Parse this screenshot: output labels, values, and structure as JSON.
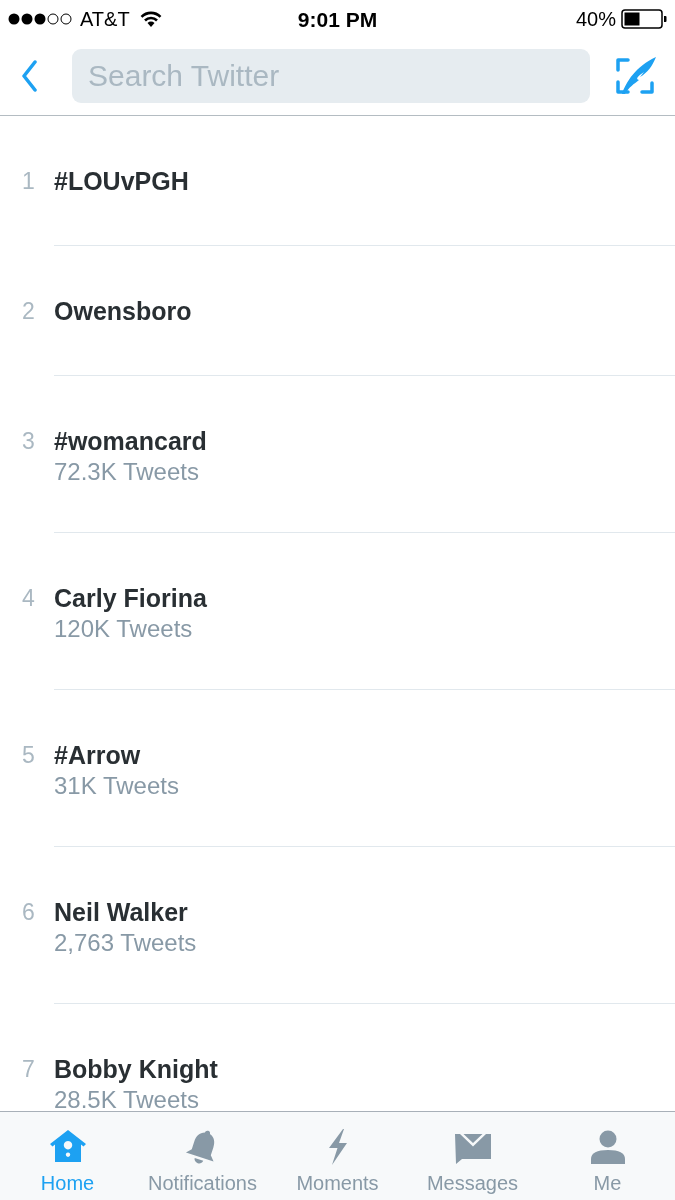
{
  "status_bar": {
    "carrier": "AT&T",
    "time": "9:01 PM",
    "battery": "40%"
  },
  "search": {
    "placeholder": "Search Twitter"
  },
  "trends": [
    {
      "rank": "1",
      "name": "#LOUvPGH"
    },
    {
      "rank": "2",
      "name": "Owensboro"
    },
    {
      "rank": "3",
      "name": "#womancard",
      "tweet_count": "72.3K Tweets"
    },
    {
      "rank": "4",
      "name": "Carly Fiorina",
      "tweet_count": "120K Tweets"
    },
    {
      "rank": "5",
      "name": "#Arrow",
      "tweet_count": "31K Tweets"
    },
    {
      "rank": "6",
      "name": "Neil Walker",
      "tweet_count": "2,763 Tweets"
    },
    {
      "rank": "7",
      "name": "Bobby Knight",
      "tweet_count": "28.5K Tweets"
    }
  ],
  "tab_bar": [
    {
      "label": "Home",
      "selected": true
    },
    {
      "label": "Notifications",
      "selected": false
    },
    {
      "label": "Moments",
      "selected": false
    },
    {
      "label": "Messages",
      "selected": false
    },
    {
      "label": "Me",
      "selected": false
    }
  ]
}
